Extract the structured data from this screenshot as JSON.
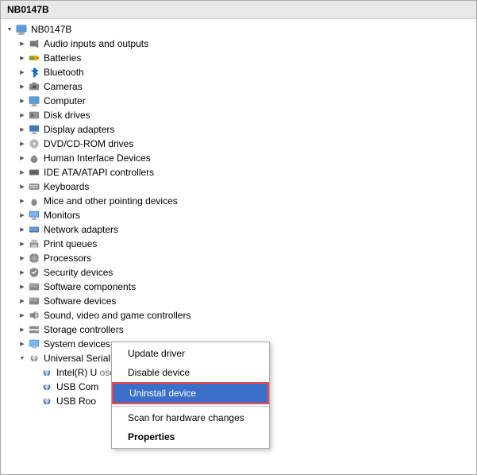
{
  "title": "NB0147B",
  "tree": {
    "root": "NB0147B",
    "items": [
      {
        "id": "audio",
        "label": "Audio inputs and outputs",
        "icon": "🔊",
        "indent": 1,
        "chevron": "collapsed"
      },
      {
        "id": "batteries",
        "label": "Batteries",
        "icon": "🔋",
        "indent": 1,
        "chevron": "collapsed"
      },
      {
        "id": "bluetooth",
        "label": "Bluetooth",
        "icon": "⬡",
        "indent": 1,
        "chevron": "collapsed"
      },
      {
        "id": "cameras",
        "label": "Cameras",
        "icon": "📷",
        "indent": 1,
        "chevron": "collapsed"
      },
      {
        "id": "computer",
        "label": "Computer",
        "icon": "🖥",
        "indent": 1,
        "chevron": "collapsed"
      },
      {
        "id": "disk",
        "label": "Disk drives",
        "icon": "💾",
        "indent": 1,
        "chevron": "collapsed"
      },
      {
        "id": "display",
        "label": "Display adapters",
        "icon": "🖥",
        "indent": 1,
        "chevron": "collapsed"
      },
      {
        "id": "dvd",
        "label": "DVD/CD-ROM drives",
        "icon": "💿",
        "indent": 1,
        "chevron": "collapsed"
      },
      {
        "id": "hid",
        "label": "Human Interface Devices",
        "icon": "🖱",
        "indent": 1,
        "chevron": "collapsed"
      },
      {
        "id": "ide",
        "label": "IDE ATA/ATAPI controllers",
        "icon": "⚙",
        "indent": 1,
        "chevron": "collapsed"
      },
      {
        "id": "keyboards",
        "label": "Keyboards",
        "icon": "⌨",
        "indent": 1,
        "chevron": "collapsed"
      },
      {
        "id": "mice",
        "label": "Mice and other pointing devices",
        "icon": "🖱",
        "indent": 1,
        "chevron": "collapsed"
      },
      {
        "id": "monitors",
        "label": "Monitors",
        "icon": "🖥",
        "indent": 1,
        "chevron": "collapsed"
      },
      {
        "id": "network",
        "label": "Network adapters",
        "icon": "🌐",
        "indent": 1,
        "chevron": "collapsed"
      },
      {
        "id": "print",
        "label": "Print queues",
        "icon": "🖨",
        "indent": 1,
        "chevron": "collapsed"
      },
      {
        "id": "processors",
        "label": "Processors",
        "icon": "⚙",
        "indent": 1,
        "chevron": "collapsed"
      },
      {
        "id": "security",
        "label": "Security devices",
        "icon": "🔒",
        "indent": 1,
        "chevron": "collapsed"
      },
      {
        "id": "sw-components",
        "label": "Software components",
        "icon": "📦",
        "indent": 1,
        "chevron": "collapsed"
      },
      {
        "id": "sw-devices",
        "label": "Software devices",
        "icon": "📦",
        "indent": 1,
        "chevron": "collapsed"
      },
      {
        "id": "sound",
        "label": "Sound, video and game controllers",
        "icon": "🔊",
        "indent": 1,
        "chevron": "collapsed"
      },
      {
        "id": "storage",
        "label": "Storage controllers",
        "icon": "💾",
        "indent": 1,
        "chevron": "collapsed"
      },
      {
        "id": "system",
        "label": "System devices",
        "icon": "🖥",
        "indent": 1,
        "chevron": "collapsed"
      },
      {
        "id": "usb",
        "label": "Universal Serial Bus controllers",
        "icon": "🔌",
        "indent": 1,
        "chevron": "expanded"
      },
      {
        "id": "intel-usb",
        "label": "Intel(R) U",
        "label_suffix": "                                    osoft)",
        "indent": 2,
        "chevron": "empty",
        "selected": false
      },
      {
        "id": "usb-com",
        "label": "USB Com",
        "indent": 2,
        "chevron": "empty"
      },
      {
        "id": "usb-root",
        "label": "USB Roo",
        "indent": 2,
        "chevron": "empty"
      }
    ]
  },
  "context_menu": {
    "items": [
      {
        "id": "update",
        "label": "Update driver",
        "type": "normal"
      },
      {
        "id": "disable",
        "label": "Disable device",
        "type": "normal"
      },
      {
        "id": "uninstall",
        "label": "Uninstall device",
        "type": "highlighted"
      },
      {
        "id": "scan",
        "label": "Scan for hardware changes",
        "type": "normal"
      },
      {
        "id": "properties",
        "label": "Properties",
        "type": "bold"
      }
    ]
  }
}
